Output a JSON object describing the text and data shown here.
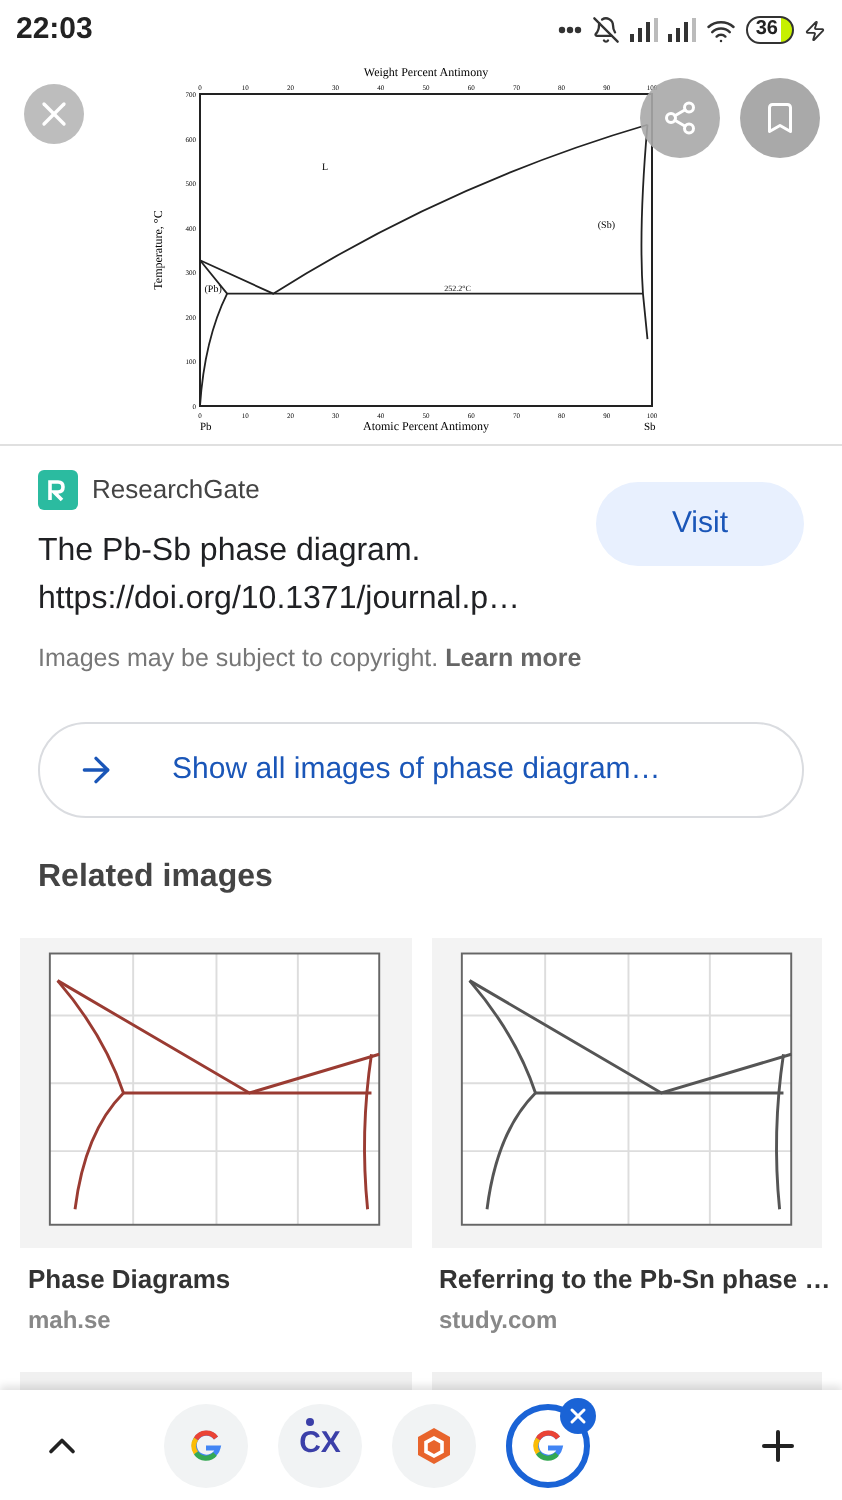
{
  "status_bar": {
    "time": "22:03",
    "battery": "36"
  },
  "diagram": {
    "top_title": "Weight Percent Antimony",
    "bottom_title": "Atomic Percent Antimony",
    "y_title": "Temperature, °C",
    "top_ticks": [
      "0",
      "10",
      "20",
      "30",
      "40",
      "50",
      "60",
      "70",
      "80",
      "90",
      "100"
    ],
    "bottom_ticks": [
      "0",
      "10",
      "20",
      "30",
      "40",
      "50",
      "60",
      "70",
      "80",
      "90",
      "100"
    ],
    "left_ticks": [
      "700",
      "600",
      "500",
      "400",
      "300",
      "200",
      "100",
      "0"
    ],
    "region_labels": [
      "L",
      "(Pb)",
      "(Sb)"
    ],
    "eutectic_temp": "252.2°C",
    "left_element": "Pb",
    "right_element": "Sb"
  },
  "result": {
    "source": "ResearchGate",
    "title": "The Pb-Sb phase diagram.",
    "link": "https://doi.org/10.1371/journal.p…",
    "visit": "Visit",
    "copyright": "Images may be subject to copyright.",
    "learn_more": "Learn more"
  },
  "show_all": "Show all images of phase diagram…",
  "related": {
    "heading": "Related images",
    "items": [
      {
        "kind": "picture",
        "title": "Phase Diagrams",
        "site": "mah.se"
      },
      {
        "kind": "picture",
        "title": "Referring to the Pb-Sn phase …",
        "site": "study.com"
      }
    ]
  },
  "tabs": [
    {
      "kind": "google",
      "selected": false
    },
    {
      "kind": "text",
      "label": "CX",
      "selected": false
    },
    {
      "kind": "hexagon",
      "selected": false
    },
    {
      "kind": "google",
      "selected": true
    }
  ]
}
